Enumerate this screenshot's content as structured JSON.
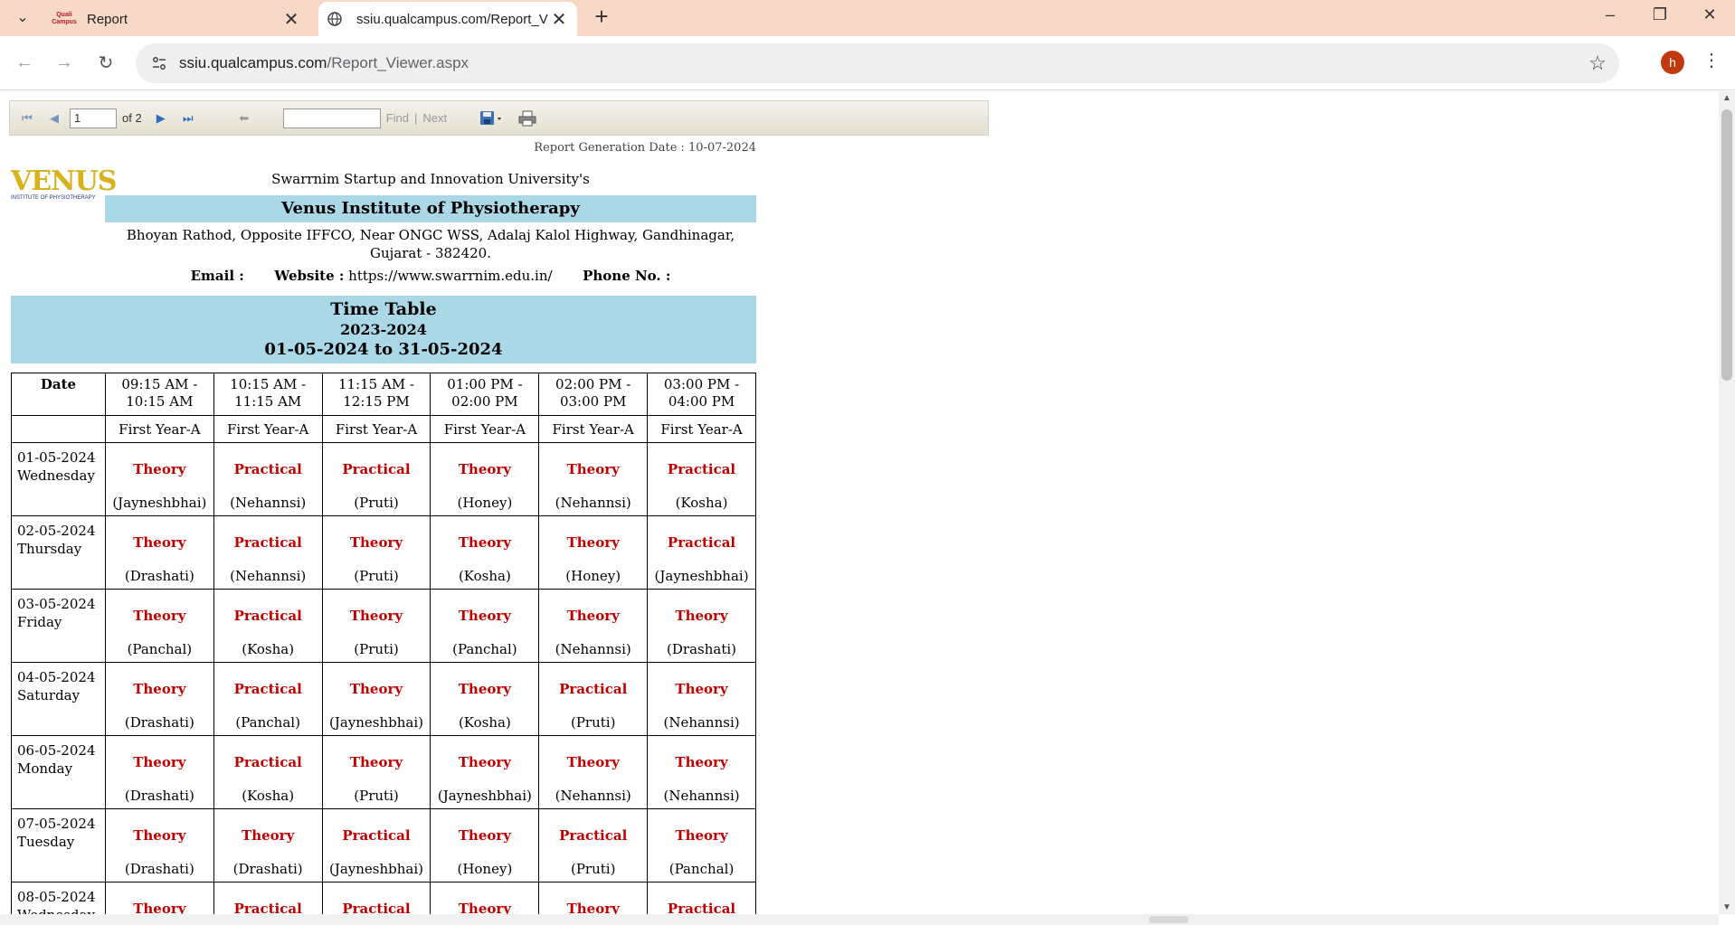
{
  "browser": {
    "tabs": [
      {
        "title": "Report",
        "favicon": "qualcampus-logo",
        "favicon_text": "Quali Campus"
      },
      {
        "title": "ssiu.qualcampus.com/Report_Vi",
        "favicon": "globe-icon",
        "active": true
      }
    ],
    "url_host": "ssiu.qualcampus.com",
    "url_path": "/Report_Viewer.aspx",
    "profile_initial": "h"
  },
  "toolbar": {
    "page_current": "1",
    "page_total_label": "of 2",
    "find_label": "Find",
    "separator": "|",
    "next_label": "Next",
    "find_value": ""
  },
  "report": {
    "generation_date": "Report Generation Date : 10-07-2024",
    "logo_text": "VENUS",
    "logo_subtext": "INSTITUTE OF PHYSIOTHERAPY",
    "university": "Swarrnim Startup and Innovation University's",
    "institute": "Venus Institute of Physiotherapy",
    "address": "Bhoyan Rathod, Opposite IFFCO, Near ONGC WSS, Adalaj Kalol Highway, Gandhinagar, Gujarat - 382420.",
    "email_label": "Email :",
    "email_value": "",
    "website_label": "Website :",
    "website_value": "https://www.swarrnim.edu.in/",
    "phone_label": "Phone No. :",
    "phone_value": "",
    "title": "Time Table",
    "year": "2023-2024",
    "period": "01-05-2024 to 31-05-2024",
    "colors": {
      "header_bg": "#abd8e6",
      "session_type": "#c00000"
    }
  },
  "timetable": {
    "date_header": "Date",
    "slots": [
      {
        "start": "09:15 AM -",
        "end": "10:15 AM"
      },
      {
        "start": "10:15 AM -",
        "end": "11:15 AM"
      },
      {
        "start": "11:15 AM -",
        "end": "12:15 PM"
      },
      {
        "start": "01:00 PM -",
        "end": "02:00 PM"
      },
      {
        "start": "02:00 PM -",
        "end": "03:00 PM"
      },
      {
        "start": "03:00 PM -",
        "end": "04:00 PM"
      }
    ],
    "batch": [
      "First Year-A",
      "First Year-A",
      "First Year-A",
      "First Year-A",
      "First Year-A",
      "First Year-A"
    ],
    "rows": [
      {
        "date": "01-05-2024",
        "day": "Wednesday",
        "cells": [
          {
            "type": "Theory",
            "faculty": "(Jayneshbhai)"
          },
          {
            "type": "Practical",
            "faculty": "(Nehannsi)"
          },
          {
            "type": "Practical",
            "faculty": "(Pruti)"
          },
          {
            "type": "Theory",
            "faculty": "(Honey)"
          },
          {
            "type": "Theory",
            "faculty": "(Nehannsi)"
          },
          {
            "type": "Practical",
            "faculty": "(Kosha)"
          }
        ]
      },
      {
        "date": "02-05-2024",
        "day": "Thursday",
        "cells": [
          {
            "type": "Theory",
            "faculty": "(Drashati)"
          },
          {
            "type": "Practical",
            "faculty": "(Nehannsi)"
          },
          {
            "type": "Theory",
            "faculty": "(Pruti)"
          },
          {
            "type": "Theory",
            "faculty": "(Kosha)"
          },
          {
            "type": "Theory",
            "faculty": "(Honey)"
          },
          {
            "type": "Practical",
            "faculty": "(Jayneshbhai)"
          }
        ]
      },
      {
        "date": "03-05-2024",
        "day": "Friday",
        "cells": [
          {
            "type": "Theory",
            "faculty": "(Panchal)"
          },
          {
            "type": "Practical",
            "faculty": "(Kosha)"
          },
          {
            "type": "Theory",
            "faculty": "(Pruti)"
          },
          {
            "type": "Theory",
            "faculty": "(Panchal)"
          },
          {
            "type": "Theory",
            "faculty": "(Nehannsi)"
          },
          {
            "type": "Theory",
            "faculty": "(Drashati)"
          }
        ]
      },
      {
        "date": "04-05-2024",
        "day": "Saturday",
        "cells": [
          {
            "type": "Theory",
            "faculty": "(Drashati)"
          },
          {
            "type": "Practical",
            "faculty": "(Panchal)"
          },
          {
            "type": "Theory",
            "faculty": "(Jayneshbhai)"
          },
          {
            "type": "Theory",
            "faculty": "(Kosha)"
          },
          {
            "type": "Practical",
            "faculty": "(Pruti)"
          },
          {
            "type": "Theory",
            "faculty": "(Nehannsi)"
          }
        ]
      },
      {
        "date": "06-05-2024",
        "day": "Monday",
        "cells": [
          {
            "type": "Theory",
            "faculty": "(Drashati)"
          },
          {
            "type": "Practical",
            "faculty": "(Kosha)"
          },
          {
            "type": "Theory",
            "faculty": "(Pruti)"
          },
          {
            "type": "Theory",
            "faculty": "(Jayneshbhai)"
          },
          {
            "type": "Theory",
            "faculty": "(Nehannsi)"
          },
          {
            "type": "Theory",
            "faculty": "(Nehannsi)"
          }
        ]
      },
      {
        "date": "07-05-2024",
        "day": "Tuesday",
        "cells": [
          {
            "type": "Theory",
            "faculty": "(Drashati)"
          },
          {
            "type": "Theory",
            "faculty": "(Drashati)"
          },
          {
            "type": "Practical",
            "faculty": "(Jayneshbhai)"
          },
          {
            "type": "Theory",
            "faculty": "(Honey)"
          },
          {
            "type": "Practical",
            "faculty": "(Pruti)"
          },
          {
            "type": "Theory",
            "faculty": "(Panchal)"
          }
        ]
      },
      {
        "date": "08-05-2024",
        "day": "Wednesday",
        "cells": [
          {
            "type": "Theory",
            "faculty": ""
          },
          {
            "type": "Practical",
            "faculty": ""
          },
          {
            "type": "Practical",
            "faculty": ""
          },
          {
            "type": "Theory",
            "faculty": ""
          },
          {
            "type": "Theory",
            "faculty": ""
          },
          {
            "type": "Practical",
            "faculty": ""
          }
        ]
      }
    ]
  }
}
